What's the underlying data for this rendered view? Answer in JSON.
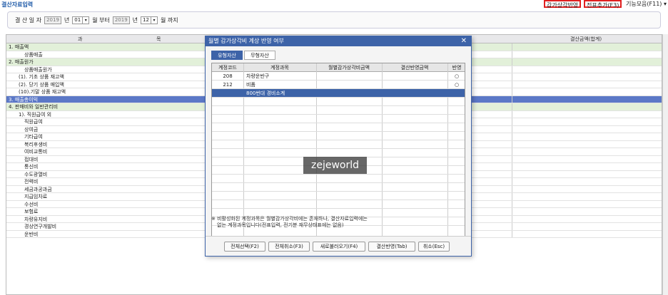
{
  "app": {
    "title": "결산자료입력",
    "buttons": {
      "depr_reflect": "감가상각반영",
      "add_entry": "전표추가(F3)",
      "tools": "기능모음(F11) ▾"
    }
  },
  "filter": {
    "label": "결 산 일 자",
    "year_from": "2019",
    "year_unit": "년",
    "month_from": "01",
    "from_text": "월 부터",
    "year_to": "2019",
    "month_to": "12",
    "to_text": "월 까지"
  },
  "grid": {
    "col_account": "과",
    "col_item": "목",
    "col_total": "결산금액(합계)",
    "rows": [
      {
        "label": "1. 매출액",
        "style": "sec"
      },
      {
        "label": "상품매출",
        "style": ""
      },
      {
        "label": "2. 매출원가",
        "style": "sec"
      },
      {
        "label": "상품매출원가",
        "style": ""
      },
      {
        "label": "(1). 기초 상품 재고액",
        "style": ""
      },
      {
        "label": "(2). 당기 상품 매입액",
        "style": ""
      },
      {
        "label": "(10).기말 상품 재고액",
        "style": ""
      },
      {
        "label": "3. 매출총이익",
        "style": "hl"
      },
      {
        "label": "4. 판매비와 일반관리비",
        "style": "sec"
      },
      {
        "label": "1). 직원급여 외",
        "style": ""
      },
      {
        "label": "직원급여",
        "style": ""
      },
      {
        "label": "상여금",
        "style": ""
      },
      {
        "label": "기타급여",
        "style": ""
      },
      {
        "label": "복리후생비",
        "style": ""
      },
      {
        "label": "여비교통비",
        "style": ""
      },
      {
        "label": "접대비",
        "style": ""
      },
      {
        "label": "통신비",
        "style": ""
      },
      {
        "label": "수도광열비",
        "style": ""
      },
      {
        "label": "전력비",
        "style": ""
      },
      {
        "label": "세금과공과금",
        "style": ""
      },
      {
        "label": "지급임차료",
        "style": ""
      },
      {
        "label": "수선비",
        "style": ""
      },
      {
        "label": "보험료",
        "style": ""
      },
      {
        "label": "차량유지비",
        "style": ""
      },
      {
        "label": "경상연구개발비",
        "style": ""
      },
      {
        "label": "운반비",
        "style": ""
      }
    ]
  },
  "modal": {
    "title": "월별 감가상각비 계상 반영 여부",
    "close": "✕",
    "tabs": [
      "유형자산",
      "무형자산"
    ],
    "columns": [
      "계정코드",
      "계정과목",
      "월별감가상각비금액",
      "결산반영금액",
      "반영"
    ],
    "rows": [
      {
        "code": "208",
        "name": "차량운반구",
        "flag": "○"
      },
      {
        "code": "212",
        "name": "비품",
        "flag": "○"
      },
      {
        "code": "",
        "name": "800번대 경비소계",
        "flag": ""
      }
    ],
    "note_line1": "※ 비활성화된 계정과목은 월별감가상각비에는 존재하나, 결산자료입력에는",
    "note_line2": "없는 계정과목입니다(전표입력, 전기분 재무상태표에는 없음)",
    "buttons": {
      "select_all": "전체선택(F2)",
      "cancel_all": "전체취소(F3)",
      "reload": "새로불러오기(F4)",
      "apply": "결산반영(Tab)",
      "cancel": "취소(Esc)"
    }
  },
  "watermark": "zejeworld",
  "colors": {
    "modal_header": "#3d63a8",
    "highlight_row": "#5b78c7",
    "section_row": "#e2f0d9",
    "red_frame": "#e02020"
  }
}
